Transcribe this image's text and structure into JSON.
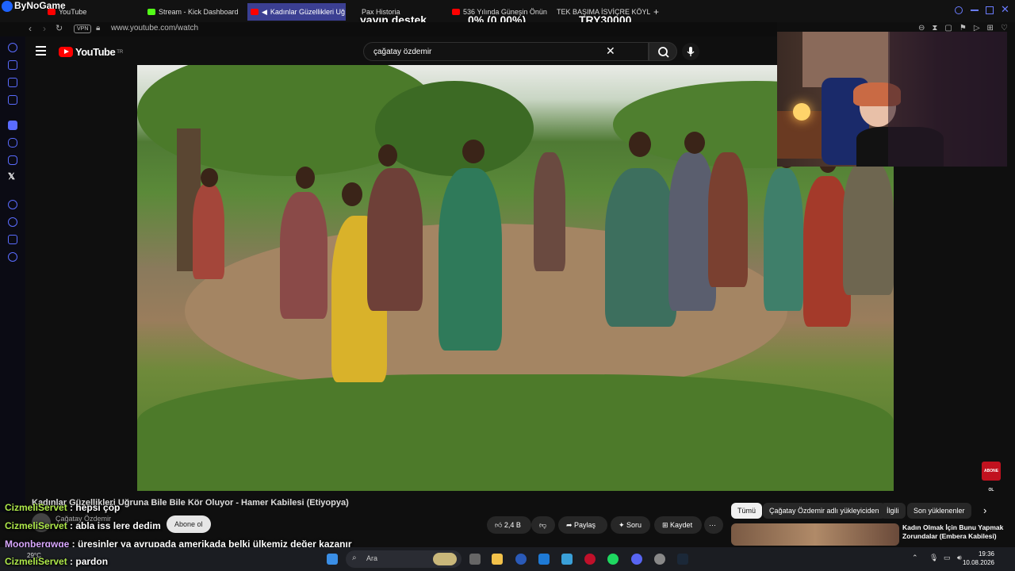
{
  "overlay": {
    "brand": "ByNoGame",
    "stat_left": "yayın destek",
    "stat_mid": "0% (0.00%)",
    "stat_right": "TRY30000"
  },
  "browser": {
    "tabs": [
      {
        "label": "YouTube",
        "color": "#ff0000"
      },
      {
        "label": "Stream - Kick Dashboard",
        "color": "#53fc18"
      },
      {
        "label": "Kadınlar Güzellikleri Uğ",
        "color": "#ff0000",
        "active": true
      },
      {
        "label": "Pax Historia",
        "color": "#888888"
      },
      {
        "label": "536 Yılında Güneşin Önün",
        "color": "#ff0000"
      },
      {
        "label": "TEK BAŞIMA İSVİÇRE KÖYL",
        "color": "#ff0000"
      }
    ],
    "new_tab": "+",
    "vpn": "VPN",
    "url": "www.youtube.com/watch"
  },
  "youtube": {
    "logo_text": "YouTube",
    "logo_region": "TR",
    "search_value": "çağatay özdemir",
    "video_title": "Kadınlar Güzellikleri Uğruna Bile Bile Kör Oluyor - Hamer Kabilesi (Etiyopya)",
    "channel": "Çağatay Özdemir",
    "subscribe": "Abone ol",
    "likes": "2,4 B",
    "share": "Paylaş",
    "ask": "Soru",
    "save": "Kaydet",
    "more": "···",
    "chips": [
      "Tümü",
      "Çağatay Özdemir adlı yükleyiciden",
      "İlgili",
      "Son yüklenenler"
    ],
    "rec_title": "Kadın Olmak İçin Bunu Yapmak Zorundalar (Embera Kabilesi)"
  },
  "chat": [
    {
      "user": "CizmeliServet",
      "msg": "hepsi çöp"
    },
    {
      "user": "CizmeliServet",
      "msg": "abla iss lere dedim"
    },
    {
      "user": "Moonberqwqe",
      "msg": "üresinler ya avrupada amerikada belki ülkemiz değer kazanır"
    },
    {
      "user": "CizmeliServet",
      "msg": "pardon"
    }
  ],
  "taskbar": {
    "search_placeholder": "Ara",
    "weather": "29°C",
    "time": "19:36",
    "date": "10.08.2026"
  },
  "badge": "ABONE OL"
}
